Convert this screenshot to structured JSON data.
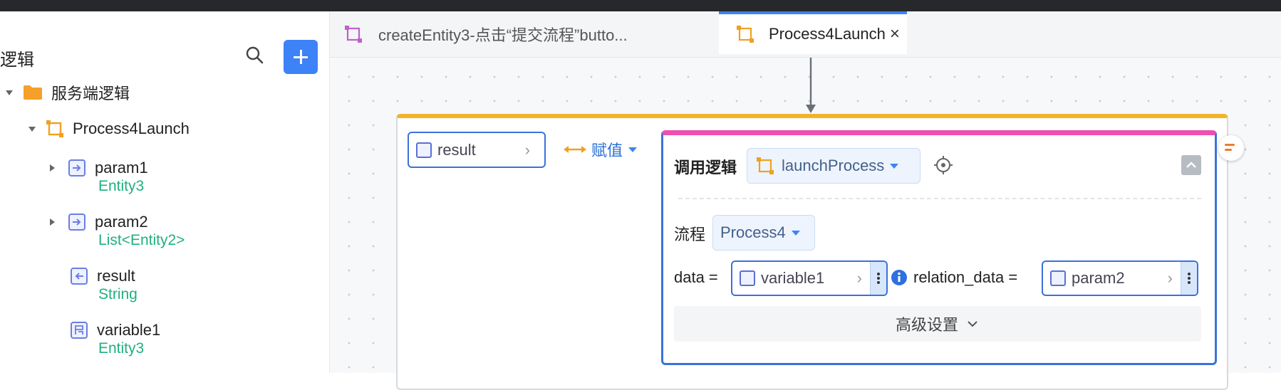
{
  "sidebar": {
    "title": "逻辑",
    "tree": [
      {
        "label": "服务端逻辑"
      },
      {
        "label": "Process4Launch"
      },
      {
        "label": "param1",
        "type": "Entity3"
      },
      {
        "label": "param2",
        "type": "List<Entity2>"
      },
      {
        "label": "result",
        "type": "String"
      },
      {
        "label": "variable1",
        "type": "Entity3"
      }
    ]
  },
  "tabs": [
    {
      "label": "createEntity3-点击“提交流程”butto..."
    },
    {
      "label": "Process4Launch",
      "close": "×"
    }
  ],
  "canvas": {
    "left_operand": "result",
    "assign_label": "赋值",
    "call_block": {
      "title": "调用逻辑",
      "logic": "launchProcess",
      "process_label": "流程",
      "process_value": "Process4",
      "data_label": "data =",
      "data_value": "variable1",
      "relation_label": "relation_data =",
      "relation_value": "param2",
      "advanced": "高级设置"
    }
  },
  "colors": {
    "accent": "#3d82f6",
    "type_green": "#1fb080",
    "call_pink": "#ee4fb1",
    "outer_yellow": "#f0b429"
  }
}
